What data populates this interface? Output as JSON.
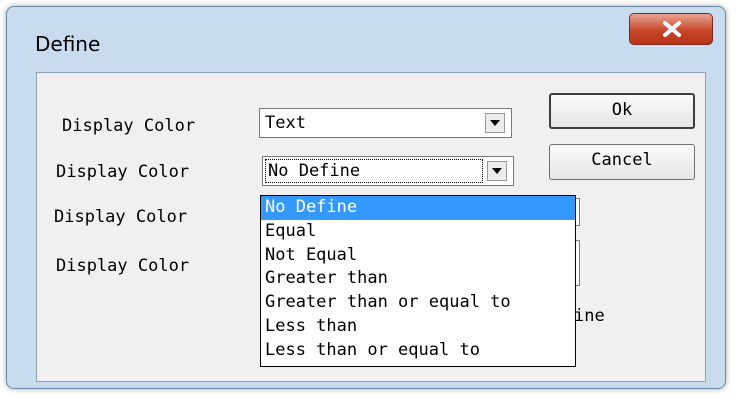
{
  "window": {
    "title": "Define"
  },
  "rows": [
    {
      "label": "Display Color",
      "value": "Text"
    },
    {
      "label": "Display Color",
      "value": "No Define"
    },
    {
      "label": "Display Color"
    },
    {
      "label": "Display Color"
    }
  ],
  "buttons": {
    "ok": "Ok",
    "cancel": "Cancel"
  },
  "dropdown": {
    "options": [
      "No Define",
      "Equal",
      "Not Equal",
      "Greater than",
      "Greater than or equal to",
      "Less than",
      "Less than or equal to"
    ],
    "selected_index": 0
  },
  "partial_text": "ine",
  "colors": {
    "selection": "#3399ff",
    "close_button": "#c7472b",
    "window_frame": "#c9dcef"
  },
  "icons": {
    "close": "close-icon",
    "dropdown": "chevron-down-icon"
  }
}
